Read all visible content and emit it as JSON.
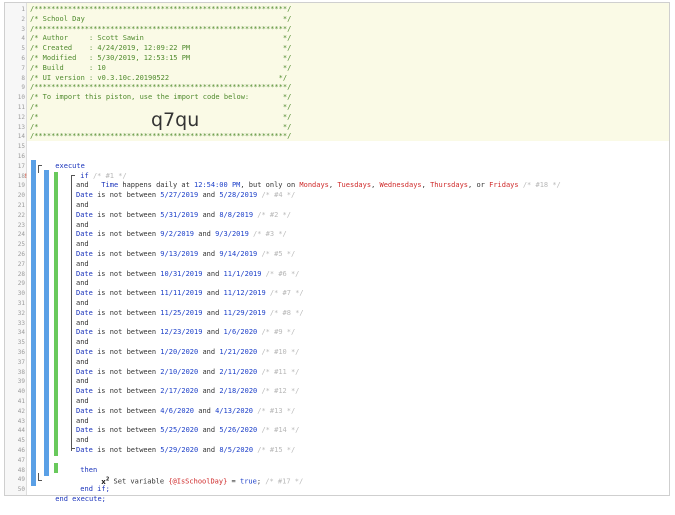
{
  "header": {
    "line1": "/************************************************************/",
    "line2": "/* School Day                                               */",
    "line3": "/************************************************************/",
    "line4": "/* Author     : Scott Sawin                                 */",
    "line5": "/* Created    : 4/24/2019, 12:09:22 PM                      */",
    "line6": "/* Modified   : 5/30/2019, 12:53:15 PM                      */",
    "line7": "/* Build      : 10                                          */",
    "line8": "/* UI version : v0.3.10c.20190522                          */",
    "line9": "/************************************************************/",
    "line10": "/* To import this piston, use the import code below:        */",
    "line11": "/*                                                          */",
    "line12": "/*                                                          */",
    "line13": "/*                                                          */",
    "line14": "/************************************************************/",
    "import_code": "q7qu"
  },
  "line_numbers": [
    "1",
    "2",
    "3",
    "4",
    "5",
    "6",
    "7",
    "8",
    "9",
    "10",
    "11",
    "12",
    "13",
    "14",
    "15",
    "16",
    "17",
    "18",
    "19",
    "20",
    "21",
    "22",
    "23",
    "24",
    "25",
    "26",
    "27",
    "28",
    "29",
    "30",
    "31",
    "32",
    "33",
    "34",
    "35",
    "36",
    "37",
    "38",
    "39",
    "40",
    "41",
    "42",
    "43",
    "44",
    "45",
    "46",
    "47",
    "48",
    "49",
    "50"
  ],
  "error_marker": "!",
  "code": {
    "execute": "execute",
    "if": "if",
    "if_comment": "/* #1 */",
    "time_cond": {
      "subject": "Time",
      "text1": " happens daily at ",
      "time": "12:54:00 PM",
      "text2": ", but only on ",
      "d1": "Mondays",
      "sep1": ", ",
      "d2": "Tuesdays",
      "sep2": ", ",
      "d3": "Wednesdays",
      "sep3": ", ",
      "d4": "Thursdays",
      "sep4": ", or ",
      "d5": "Fridays",
      "comment": " /* #18 */"
    },
    "and": "and",
    "date_subject": "Date",
    "not_between": " is not between ",
    "and_word": " and ",
    "conditions": [
      {
        "from": "5/27/2019",
        "to": "5/28/2019",
        "comment": " /* #4 */"
      },
      {
        "from": "5/31/2019",
        "to": "8/8/2019",
        "comment": " /* #2 */"
      },
      {
        "from": "9/2/2019",
        "to": "9/3/2019",
        "comment": " /* #3 */"
      },
      {
        "from": "9/13/2019",
        "to": "9/14/2019",
        "comment": " /* #5 */"
      },
      {
        "from": "10/31/2019",
        "to": "11/1/2019",
        "comment": " /* #6 */"
      },
      {
        "from": "11/11/2019",
        "to": "11/12/2019",
        "comment": " /* #7 */"
      },
      {
        "from": "11/25/2019",
        "to": "11/29/2019",
        "comment": " /* #8 */"
      },
      {
        "from": "12/23/2019",
        "to": "1/6/2020",
        "comment": " /* #9 */"
      },
      {
        "from": "1/20/2020",
        "to": "1/21/2020",
        "comment": " /* #10 */"
      },
      {
        "from": "2/10/2020",
        "to": "2/11/2020",
        "comment": " /* #11 */"
      },
      {
        "from": "2/17/2020",
        "to": "2/18/2020",
        "comment": " /* #12 */"
      },
      {
        "from": "4/6/2020",
        "to": "4/13/2020",
        "comment": " /* #13 */"
      },
      {
        "from": "5/25/2020",
        "to": "5/26/2020",
        "comment": " /* #14 */"
      },
      {
        "from": "5/29/2020",
        "to": "8/5/2020",
        "comment": " /* #15 */"
      }
    ],
    "then": "then",
    "set_icon": "x",
    "set_icon_sup": "2",
    "set_text": " Set variable ",
    "set_var": "{@IsSchoolDay}",
    "set_eq": " = ",
    "set_val": "true",
    "set_semi": ";",
    "set_comment": " /* #17 */",
    "end_if": "end if;",
    "end_execute": "end execute;"
  },
  "colors": {
    "keyword": "#1a33bb",
    "comment": "#4f8a2d",
    "day": "#cf2a2a",
    "bar_blue": "#5aa0e6",
    "bar_green": "#69c95c",
    "header_bg": "#fafae6"
  }
}
